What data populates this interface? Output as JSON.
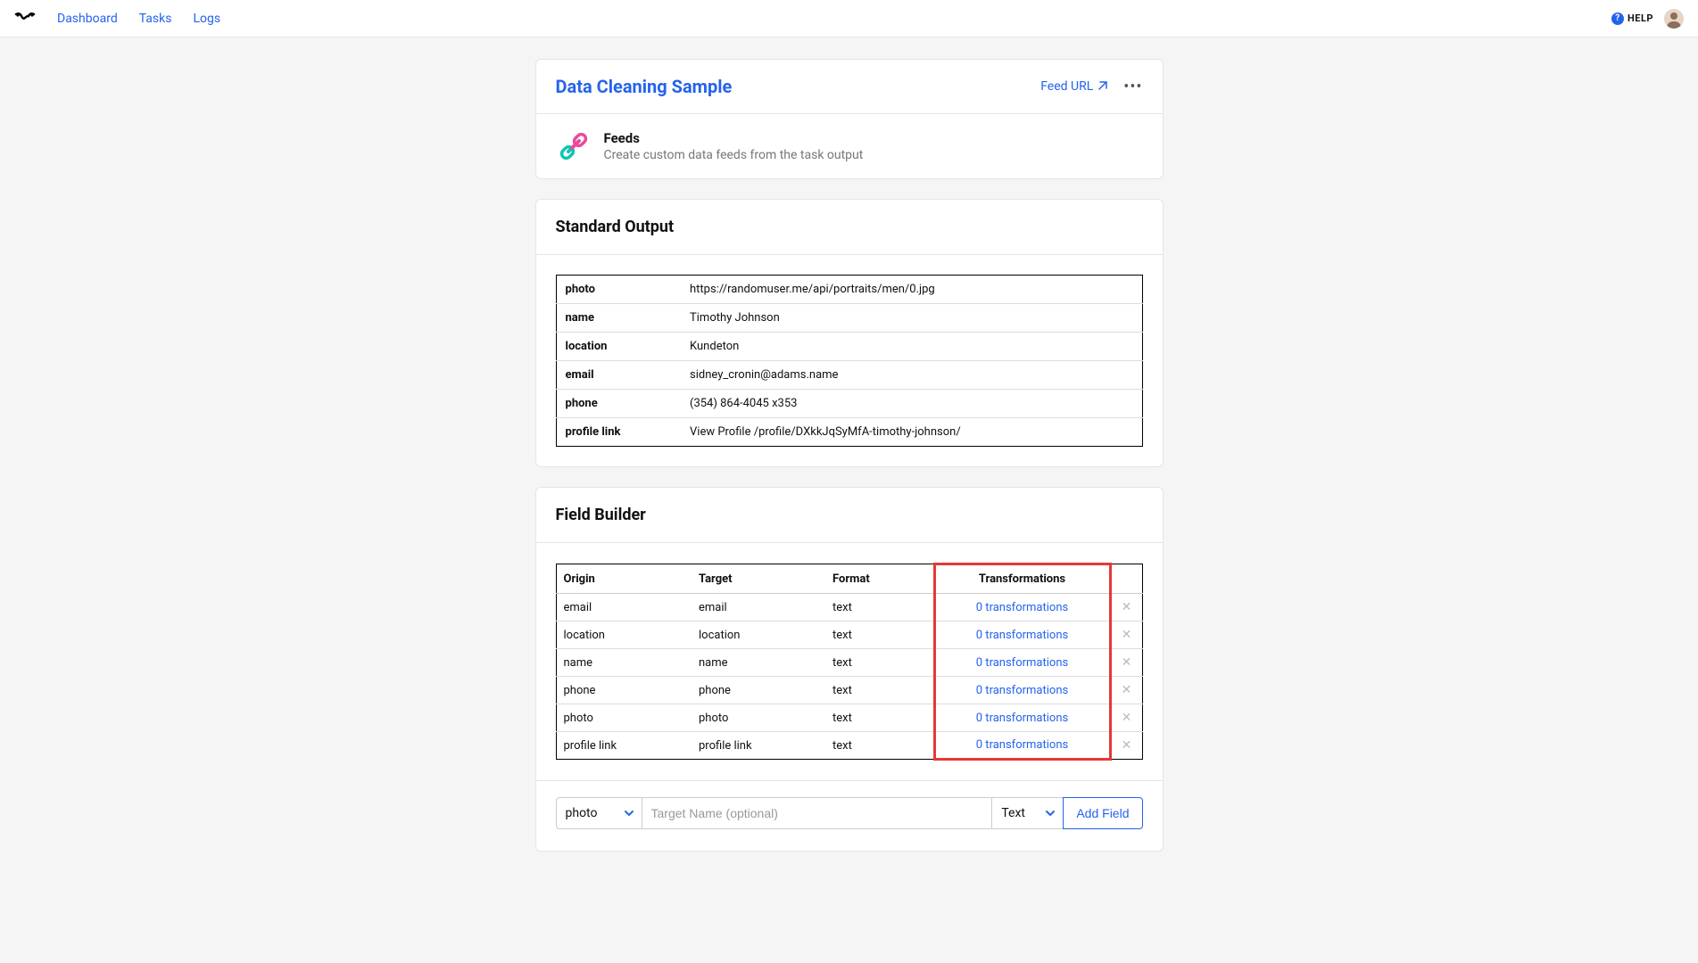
{
  "nav": {
    "dashboard": "Dashboard",
    "tasks": "Tasks",
    "logs": "Logs",
    "help": "HELP"
  },
  "header": {
    "title": "Data Cleaning Sample",
    "feed_url": "Feed URL"
  },
  "feeds": {
    "title": "Feeds",
    "desc": "Create custom data feeds from the task output"
  },
  "standard_output": {
    "title": "Standard Output",
    "rows": [
      {
        "key": "photo",
        "value": "https://randomuser.me/api/portraits/men/0.jpg"
      },
      {
        "key": "name",
        "value": "Timothy Johnson"
      },
      {
        "key": "location",
        "value": "Kundeton"
      },
      {
        "key": "email",
        "value": "sidney_cronin@adams.name"
      },
      {
        "key": "phone",
        "value": "(354) 864-4045 x353"
      },
      {
        "key": "profile link",
        "value": "View Profile /profile/DXkkJqSyMfA-timothy-johnson/"
      }
    ]
  },
  "field_builder": {
    "title": "Field Builder",
    "columns": {
      "origin": "Origin",
      "target": "Target",
      "format": "Format",
      "transformations": "Transformations"
    },
    "rows": [
      {
        "origin": "email",
        "target": "email",
        "format": "text",
        "transformations": "0 transformations"
      },
      {
        "origin": "location",
        "target": "location",
        "format": "text",
        "transformations": "0 transformations"
      },
      {
        "origin": "name",
        "target": "name",
        "format": "text",
        "transformations": "0 transformations"
      },
      {
        "origin": "phone",
        "target": "phone",
        "format": "text",
        "transformations": "0 transformations"
      },
      {
        "origin": "photo",
        "target": "photo",
        "format": "text",
        "transformations": "0 transformations"
      },
      {
        "origin": "profile link",
        "target": "profile link",
        "format": "text",
        "transformations": "0 transformations"
      }
    ],
    "add": {
      "origin_selected": "photo",
      "target_placeholder": "Target Name (optional)",
      "format_selected": "Text",
      "button": "Add Field"
    }
  }
}
